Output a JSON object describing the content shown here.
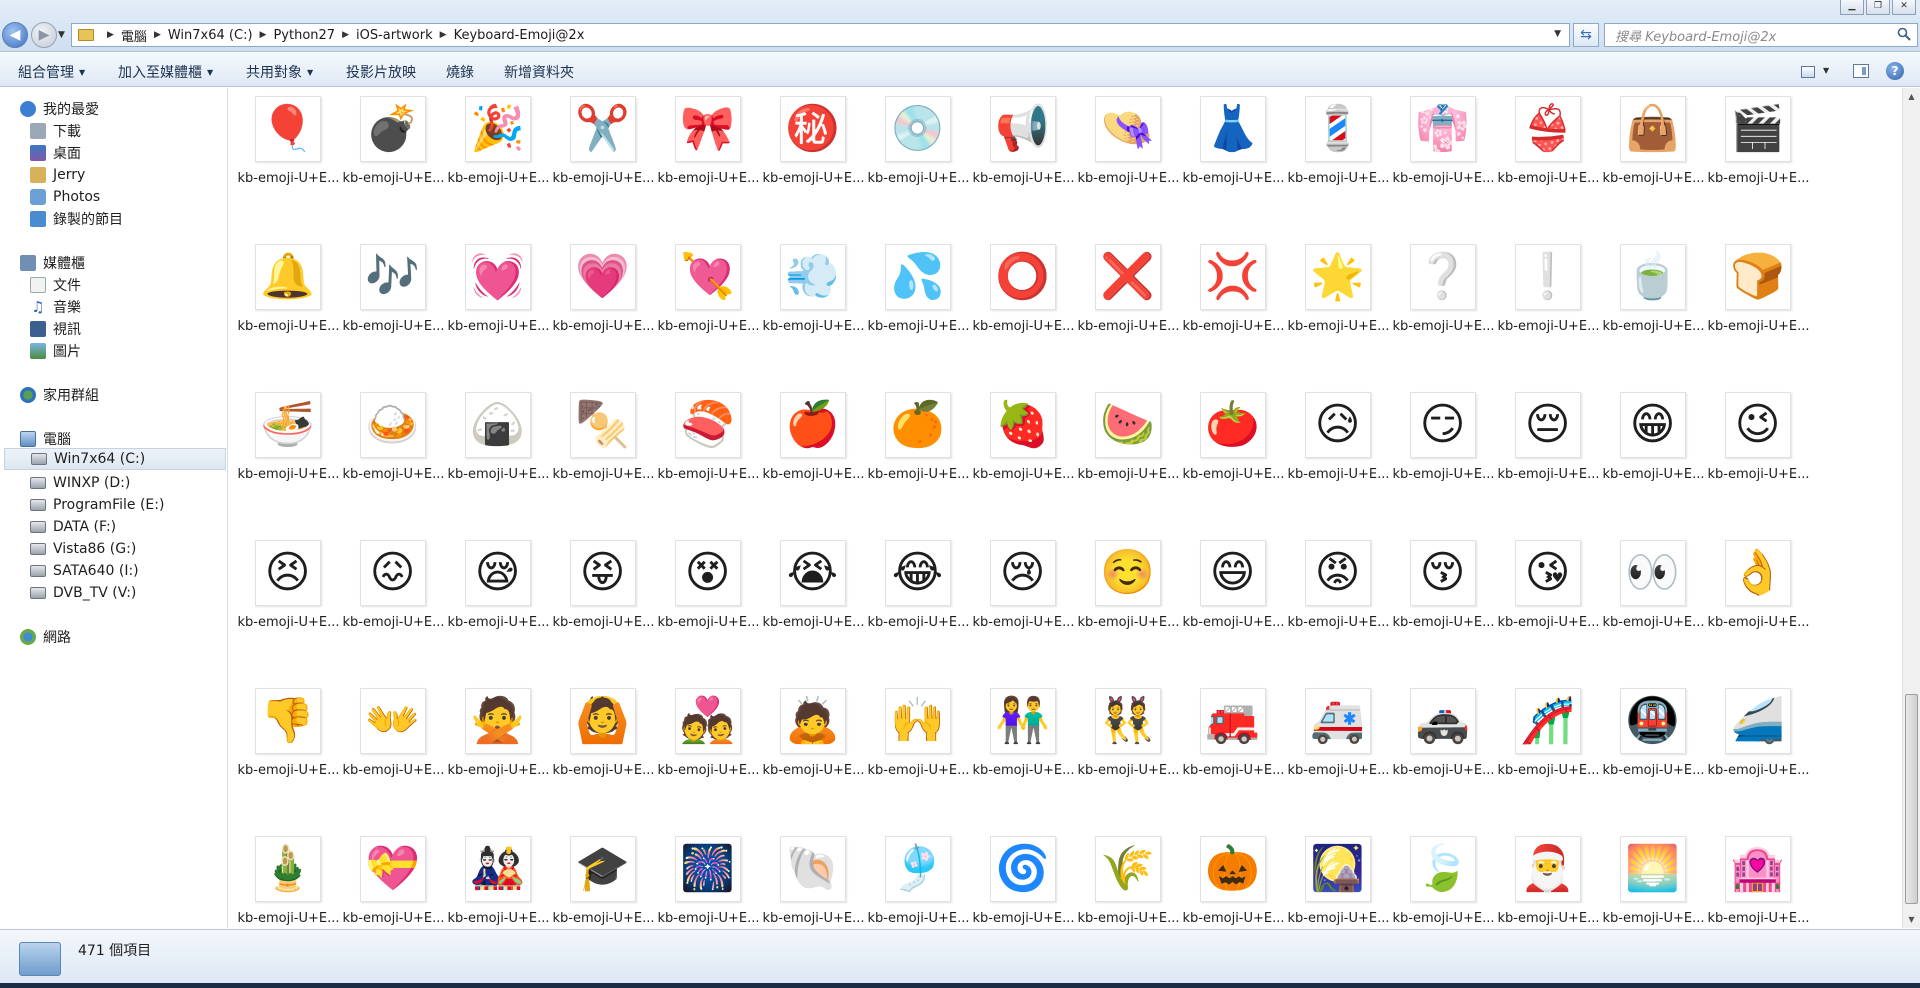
{
  "window": {
    "address_crumbs": [
      "電腦",
      "Win7x64 (C:)",
      "Python27",
      "iOS-artwork",
      "Keyboard-Emoji@2x"
    ],
    "search_placeholder": "搜尋 Keyboard-Emoji@2x"
  },
  "commands": [
    {
      "label": "組合管理",
      "dropdown": true
    },
    {
      "label": "加入至媒體櫃",
      "dropdown": true
    },
    {
      "label": "共用對象",
      "dropdown": true
    },
    {
      "label": "投影片放映",
      "dropdown": false
    },
    {
      "label": "燒錄",
      "dropdown": false
    },
    {
      "label": "新增資料夾",
      "dropdown": false
    }
  ],
  "sidebar": {
    "favorites": {
      "label": "我的最愛",
      "items": [
        "下載",
        "桌面",
        "Jerry",
        "Photos",
        "錄製的節目"
      ]
    },
    "libraries": {
      "label": "媒體櫃",
      "items": [
        "文件",
        "音樂",
        "視訊",
        "圖片"
      ]
    },
    "homegroup": "家用群組",
    "computer": {
      "label": "電腦",
      "items": [
        "Win7x64 (C:)",
        "WINXP (D:)",
        "ProgramFile (E:)",
        "DATA (F:)",
        "Vista86 (G:)",
        "SATA640 (I:)",
        "DVB_TV (V:)"
      ],
      "selected": "Win7x64 (C:)"
    },
    "network": "網路"
  },
  "files": {
    "name_label": "kb-emoji-U+E...",
    "rows": [
      [
        "🎈",
        "💣",
        "🎉",
        "✂️",
        "🎀",
        "㊙️",
        "💿",
        "📢",
        "👒",
        "👗",
        "💈",
        "👘",
        "👙",
        "👜",
        "🎬"
      ],
      [
        "🔔",
        "🎶",
        "💓",
        "💗",
        "💘",
        "💨",
        "💦",
        "⭕",
        "❌",
        "💢",
        "🌟",
        "❔",
        "❕",
        "🍵",
        "🍞"
      ],
      [
        "🍜",
        "🍛",
        "🍙",
        "🍢",
        "🍣",
        "🍎",
        "🍊",
        "🍓",
        "🍉",
        "🍅",
        "😥",
        "😏",
        "😔",
        "😁",
        "😉"
      ],
      [
        "😣",
        "😖",
        "😪",
        "😝",
        "😵",
        "😭",
        "😂",
        "😢",
        "☺️",
        "😄",
        "😡",
        "😚",
        "😘",
        "👀",
        "👌"
      ],
      [
        "👎",
        "👐",
        "🙅",
        "🙆",
        "💑",
        "🙇",
        "🙌",
        "👫",
        "👯",
        "🚒",
        "🚑",
        "🚓",
        "🎢",
        "🚇",
        "🚄"
      ],
      [
        "🎍",
        "💝",
        "🎎",
        "🎓",
        "🎆",
        "🐚",
        "🎐",
        "🌀",
        "🌾",
        "🎃",
        "🎑",
        "🍃",
        "🎅",
        "🌅",
        "🏩"
      ]
    ]
  },
  "status": {
    "item_count": "471 個項目"
  }
}
